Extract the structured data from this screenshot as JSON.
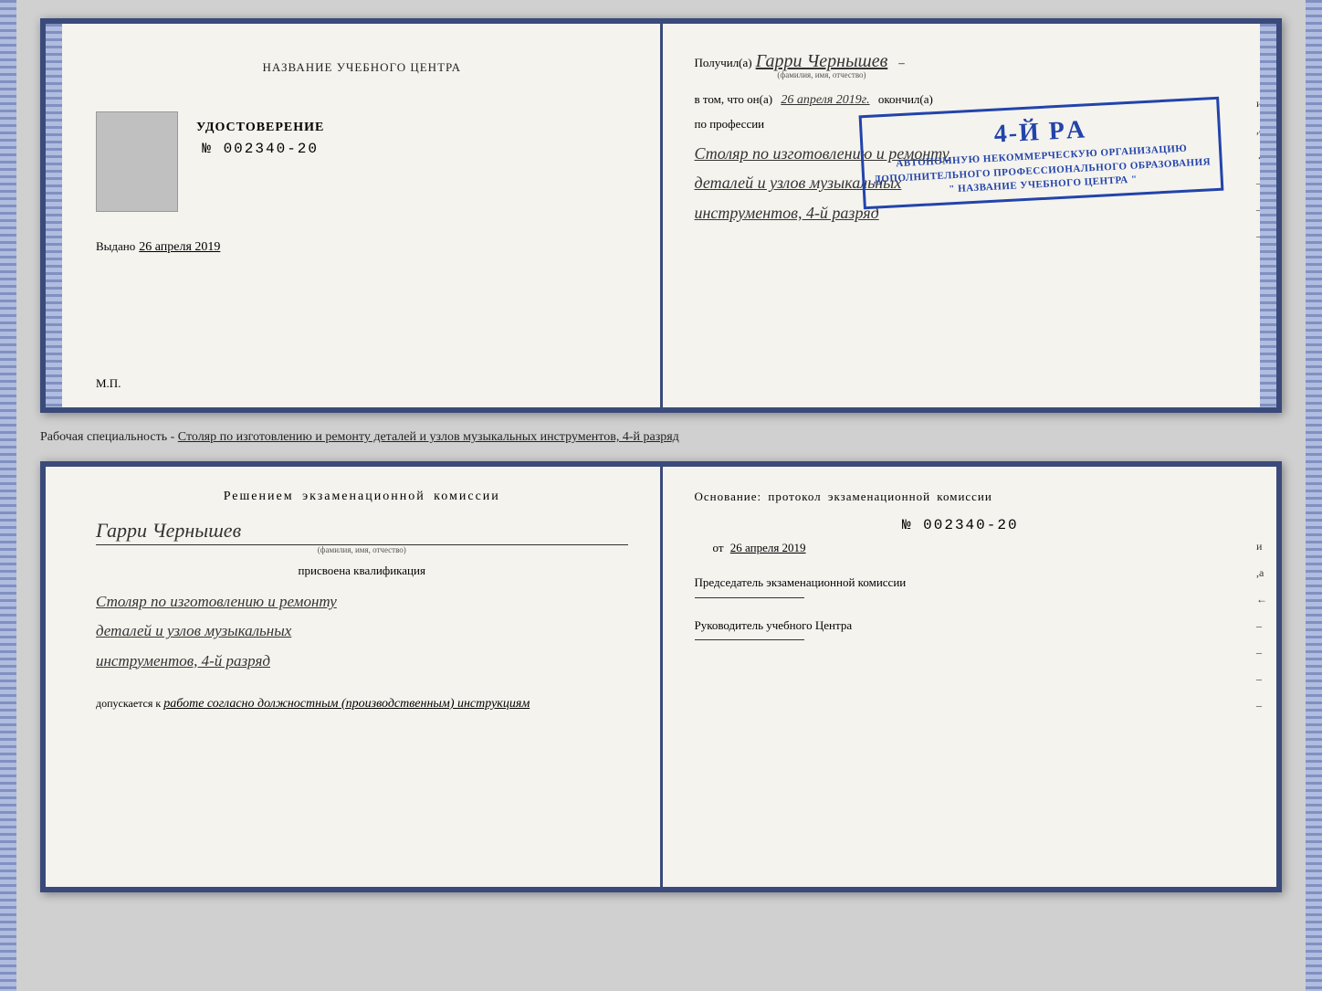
{
  "top_spread": {
    "left": {
      "center_title": "НАЗВАНИЕ УЧЕБНОГО ЦЕНТРА",
      "udost_label": "УДОСТОВЕРЕНИЕ",
      "udost_number": "№ 002340-20",
      "vydano_label": "Выдано",
      "vydano_date": "26 апреля 2019",
      "mp_label": "М.П."
    },
    "right": {
      "poluchil_prefix": "Получил(а)",
      "poluchil_name": "Гарри Чернышев",
      "fio_sublabel": "(фамилия, имя, отчество)",
      "dash1": "–",
      "vtom_prefix": "в том, что он(а)",
      "vtom_date": "26 апреля 2019г.",
      "vtom_suffix": "окончил(а)",
      "stamp_line1": "4-й рa",
      "stamp_line2": "АВТОНОМНУЮ НЕКОММЕРЧЕСКУЮ ОРГАНИЗАЦИЮ",
      "stamp_line3": "ДОПОЛНИТЕЛЬНОГО ПРОФЕССИОНАЛЬНОГО ОБРАЗОВАНИЯ",
      "stamp_line4": "\" НАЗВАНИЕ УЧЕБНОГО ЦЕНТРА \"",
      "profession_prefix": "по профессии",
      "profession_text": "Столяр по изготовлению и ремонту",
      "profession_text2": "деталей и узлов музыкальных",
      "profession_text3": "инструментов, 4-й разряд",
      "dash_и": "и",
      "dash_а": ",а",
      "dash_strelka": "←",
      "dash_minus1": "–",
      "dash_minus2": "–",
      "dash_minus3": "–"
    }
  },
  "caption": "Рабочая специальность - Столяр по изготовлению и ремонту деталей и узлов музыкальных инструментов, 4-й разряд",
  "bottom_spread": {
    "left": {
      "resheniem_title": "Решением  экзаменационной  комиссии",
      "name_handwritten": "Гарри Чернышев",
      "fio_sublabel": "(фамилия, имя, отчество)",
      "prisvoena_text": "присвоена квалификация",
      "kvalif_line1": "Столяр по изготовлению и ремонту",
      "kvalif_line2": "деталей и узлов музыкальных",
      "kvalif_line3": "инструментов, 4-й разряд",
      "dopusk_prefix": "допускается к",
      "dopusk_text": "работе согласно должностным (производственным) инструкциям"
    },
    "right": {
      "osnovanie_title": "Основание: протокол экзаменационной  комиссии",
      "protocol_number": "№  002340-20",
      "ot_label": "от",
      "ot_date": "26 апреля 2019",
      "predsedatel_label": "Председатель экзаменационной комиссии",
      "rukovoditel_label": "Руководитель учебного Центра",
      "dash_и": "и",
      "dash_а": ",а",
      "dash_strelka": "←",
      "dash_minus1": "–",
      "dash_minus2": "–",
      "dash_minus3": "–",
      "dash_minus4": "–"
    }
  }
}
